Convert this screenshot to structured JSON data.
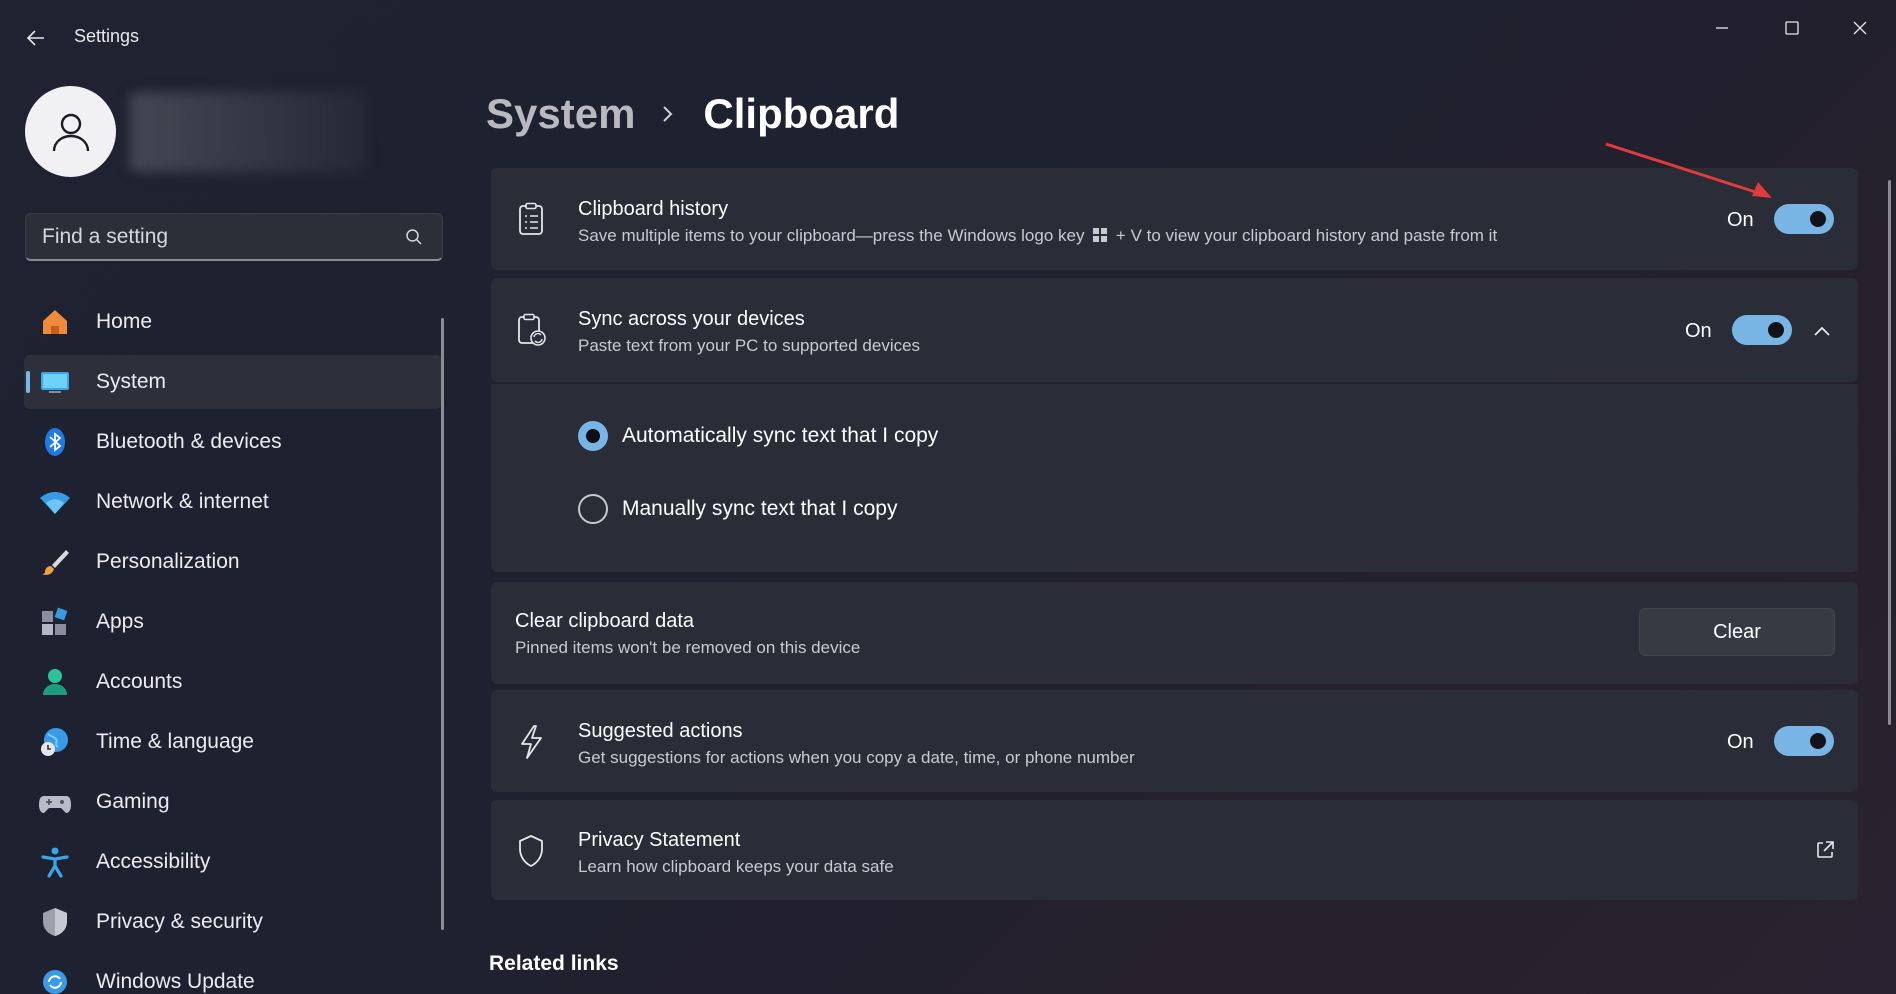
{
  "window": {
    "title": "Settings"
  },
  "search": {
    "placeholder": "Find a setting"
  },
  "sidebar": {
    "items": [
      {
        "label": "Home",
        "icon": "home-icon"
      },
      {
        "label": "System",
        "icon": "monitor-icon",
        "active": true
      },
      {
        "label": "Bluetooth & devices",
        "icon": "bluetooth-icon"
      },
      {
        "label": "Network & internet",
        "icon": "wifi-icon"
      },
      {
        "label": "Personalization",
        "icon": "brush-icon"
      },
      {
        "label": "Apps",
        "icon": "apps-icon"
      },
      {
        "label": "Accounts",
        "icon": "person-icon"
      },
      {
        "label": "Time & language",
        "icon": "globe-clock-icon"
      },
      {
        "label": "Gaming",
        "icon": "gamepad-icon"
      },
      {
        "label": "Accessibility",
        "icon": "accessibility-icon"
      },
      {
        "label": "Privacy & security",
        "icon": "shield-icon"
      },
      {
        "label": "Windows Update",
        "icon": "update-icon"
      }
    ]
  },
  "breadcrumb": {
    "parent": "System",
    "current": "Clipboard"
  },
  "cards": {
    "history": {
      "title": "Clipboard history",
      "desc_before": "Save multiple items to your clipboard—press the Windows logo key",
      "desc_after": "+ V to view your clipboard history and paste from it",
      "state": "On",
      "enabled": true
    },
    "sync": {
      "title": "Sync across your devices",
      "desc": "Paste text from your PC to supported devices",
      "state": "On",
      "enabled": true,
      "expanded": true,
      "options": [
        {
          "label": "Automatically sync text that I copy",
          "selected": true
        },
        {
          "label": "Manually sync text that I copy",
          "selected": false
        }
      ]
    },
    "clear": {
      "title": "Clear clipboard data",
      "desc": "Pinned items won't be removed on this device",
      "button": "Clear"
    },
    "suggested": {
      "title": "Suggested actions",
      "desc": "Get suggestions for actions when you copy a date, time, or phone number",
      "state": "On",
      "enabled": true
    },
    "privacy": {
      "title": "Privacy Statement",
      "desc": "Learn how clipboard keeps your data safe"
    }
  },
  "related": {
    "title": "Related links"
  },
  "colors": {
    "accent": "#79b5e4",
    "card": "#2a2c37",
    "annotation_arrow": "#e23b3b"
  }
}
